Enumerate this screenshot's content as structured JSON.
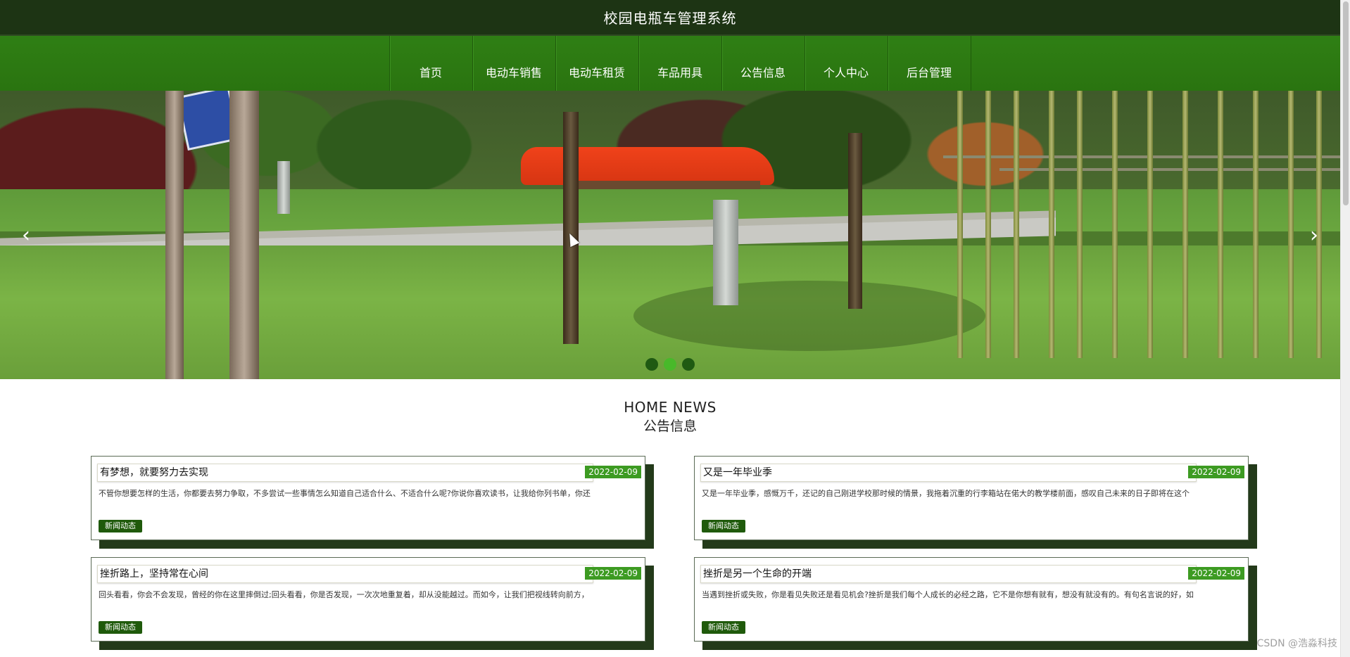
{
  "header": {
    "title": "校园电瓶车管理系统"
  },
  "nav": {
    "items": [
      {
        "label": "首页"
      },
      {
        "label": "电动车销售"
      },
      {
        "label": "电动车租赁"
      },
      {
        "label": "车品用具"
      },
      {
        "label": "公告信息"
      },
      {
        "label": "个人中心"
      },
      {
        "label": "后台管理"
      }
    ]
  },
  "carousel": {
    "prev_icon": "‹",
    "next_icon": "›",
    "slide_count": 3,
    "active_index": 1
  },
  "news": {
    "heading_en": "HOME NEWS",
    "heading_zh": "公告信息",
    "items": [
      {
        "title": "有梦想，就要努力去实现",
        "date": "2022-02-09",
        "summary": "不管你想要怎样的生活，你都要去努力争取，不多尝试一些事情怎么知道自己适合什么、不适合什么呢?你说你喜欢读书，让我给你列书单，你还",
        "tag": "新闻动态"
      },
      {
        "title": "又是一年毕业季",
        "date": "2022-02-09",
        "summary": "又是一年毕业季，感慨万千，还记的自己刚进学校那时候的情景，我拖着沉重的行李箱站在偌大的教学楼前面，感叹自己未来的日子即将在这个",
        "tag": "新闻动态"
      },
      {
        "title": "挫折路上，坚持常在心间",
        "date": "2022-02-09",
        "summary": "回头看看，你会不会发现，曾经的你在这里摔倒过;回头看看，你是否发现，一次次地重复着，却从没能越过。而如今，让我们把视线转向前方，",
        "tag": "新闻动态"
      },
      {
        "title": "挫折是另一个生命的开端",
        "date": "2022-02-09",
        "summary": "当遇到挫折或失败，你是看见失败还是看见机会?挫折是我们每个人成长的必经之路，它不是你想有就有，想没有就没有的。有句名言说的好，如",
        "tag": "新闻动态"
      }
    ]
  },
  "watermark": "CSDN @浩淼科技",
  "colors": {
    "title_bar_bg": "#1d3414",
    "nav_bg": "#2d7a12",
    "date_badge": "#3d9b22",
    "tag_bg": "#1f5a0b",
    "card_shadow": "#233a1a"
  }
}
